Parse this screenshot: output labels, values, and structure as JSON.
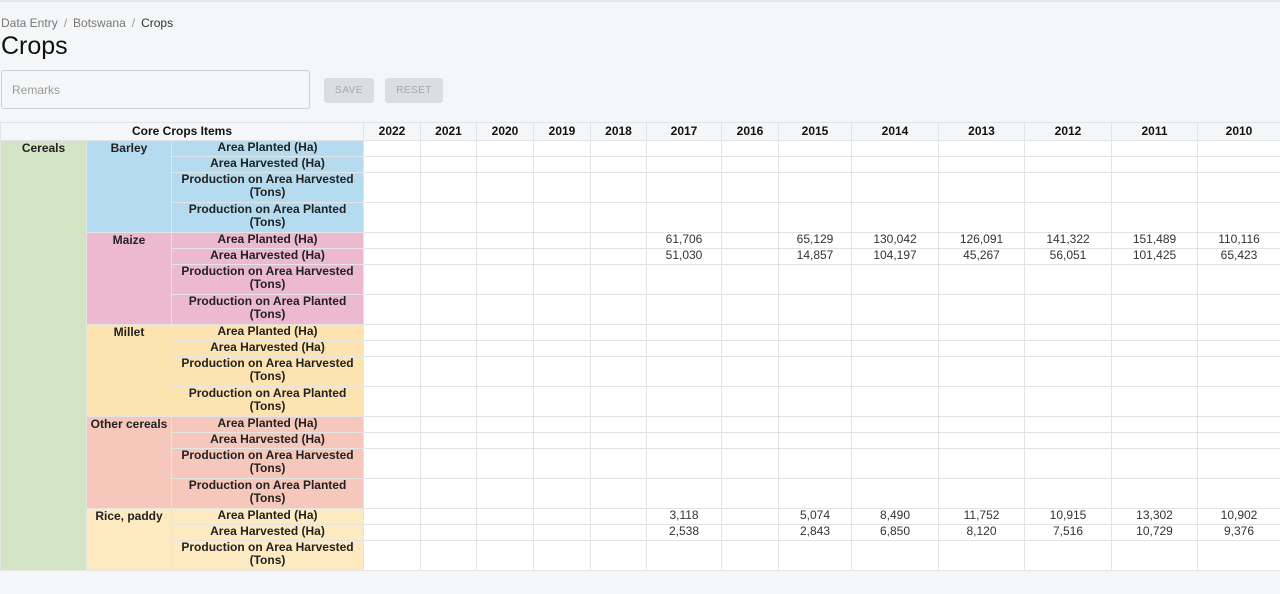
{
  "breadcrumb": [
    "Data Entry",
    "Botswana",
    "Crops"
  ],
  "page_title": "Crops",
  "remarks": {
    "placeholder": "Remarks",
    "value": ""
  },
  "buttons": {
    "save": "SAVE",
    "reset": "RESET"
  },
  "table": {
    "items_header": "Core Crops Items",
    "years": [
      "2022",
      "2021",
      "2020",
      "2019",
      "2018",
      "2017",
      "2016",
      "2015",
      "2014",
      "2013",
      "2012",
      "2011",
      "2010"
    ],
    "group": "Cereals",
    "colors": {
      "group": "#d2e4c4",
      "Barley": "#b4dbef",
      "Maize": "#ecb9cf",
      "Millet": "#fde3b0",
      "Other cereals": "#f6c7bb",
      "Rice, paddy": "#feeac0"
    },
    "crops": [
      {
        "name": "Barley",
        "rows": [
          {
            "item": "Area Planted (Ha)",
            "values": [
              "",
              "",
              "",
              "",
              "",
              "",
              "",
              "",
              "",
              "",
              "",
              "",
              ""
            ]
          },
          {
            "item": "Area Harvested (Ha)",
            "values": [
              "",
              "",
              "",
              "",
              "",
              "",
              "",
              "",
              "",
              "",
              "",
              "",
              ""
            ]
          },
          {
            "item": "Production on Area Harvested (Tons)",
            "values": [
              "",
              "",
              "",
              "",
              "",
              "",
              "",
              "",
              "",
              "",
              "",
              "",
              ""
            ]
          },
          {
            "item": "Production on Area Planted (Tons)",
            "values": [
              "",
              "",
              "",
              "",
              "",
              "",
              "",
              "",
              "",
              "",
              "",
              "",
              ""
            ]
          }
        ]
      },
      {
        "name": "Maize",
        "rows": [
          {
            "item": "Area Planted (Ha)",
            "values": [
              "",
              "",
              "",
              "",
              "",
              "61,706",
              "",
              "65,129",
              "130,042",
              "126,091",
              "141,322",
              "151,489",
              "110,116"
            ]
          },
          {
            "item": "Area Harvested (Ha)",
            "values": [
              "",
              "",
              "",
              "",
              "",
              "51,030",
              "",
              "14,857",
              "104,197",
              "45,267",
              "56,051",
              "101,425",
              "65,423"
            ]
          },
          {
            "item": "Production on Area Harvested (Tons)",
            "values": [
              "",
              "",
              "",
              "",
              "",
              "",
              "",
              "",
              "",
              "",
              "",
              "",
              ""
            ]
          },
          {
            "item": "Production on Area Planted (Tons)",
            "values": [
              "",
              "",
              "",
              "",
              "",
              "",
              "",
              "",
              "",
              "",
              "",
              "",
              ""
            ]
          }
        ]
      },
      {
        "name": "Millet",
        "rows": [
          {
            "item": "Area Planted (Ha)",
            "values": [
              "",
              "",
              "",
              "",
              "",
              "",
              "",
              "",
              "",
              "",
              "",
              "",
              ""
            ]
          },
          {
            "item": "Area Harvested (Ha)",
            "values": [
              "",
              "",
              "",
              "",
              "",
              "",
              "",
              "",
              "",
              "",
              "",
              "",
              ""
            ]
          },
          {
            "item": "Production on Area Harvested (Tons)",
            "values": [
              "",
              "",
              "",
              "",
              "",
              "",
              "",
              "",
              "",
              "",
              "",
              "",
              ""
            ]
          },
          {
            "item": "Production on Area Planted (Tons)",
            "values": [
              "",
              "",
              "",
              "",
              "",
              "",
              "",
              "",
              "",
              "",
              "",
              "",
              ""
            ]
          }
        ]
      },
      {
        "name": "Other cereals",
        "rows": [
          {
            "item": "Area Planted (Ha)",
            "values": [
              "",
              "",
              "",
              "",
              "",
              "",
              "",
              "",
              "",
              "",
              "",
              "",
              ""
            ]
          },
          {
            "item": "Area Harvested (Ha)",
            "values": [
              "",
              "",
              "",
              "",
              "",
              "",
              "",
              "",
              "",
              "",
              "",
              "",
              ""
            ]
          },
          {
            "item": "Production on Area Harvested (Tons)",
            "values": [
              "",
              "",
              "",
              "",
              "",
              "",
              "",
              "",
              "",
              "",
              "",
              "",
              ""
            ]
          },
          {
            "item": "Production on Area Planted (Tons)",
            "values": [
              "",
              "",
              "",
              "",
              "",
              "",
              "",
              "",
              "",
              "",
              "",
              "",
              ""
            ]
          }
        ]
      },
      {
        "name": "Rice, paddy",
        "rows": [
          {
            "item": "Area Planted (Ha)",
            "values": [
              "",
              "",
              "",
              "",
              "",
              "3,118",
              "",
              "5,074",
              "8,490",
              "11,752",
              "10,915",
              "13,302",
              "10,902"
            ]
          },
          {
            "item": "Area Harvested (Ha)",
            "values": [
              "",
              "",
              "",
              "",
              "",
              "2,538",
              "",
              "2,843",
              "6,850",
              "8,120",
              "7,516",
              "10,729",
              "9,376"
            ]
          },
          {
            "item": "Production on Area Harvested (Tons)",
            "values": [
              "",
              "",
              "",
              "",
              "",
              "",
              "",
              "",
              "",
              "",
              "",
              "",
              ""
            ]
          }
        ]
      }
    ]
  }
}
